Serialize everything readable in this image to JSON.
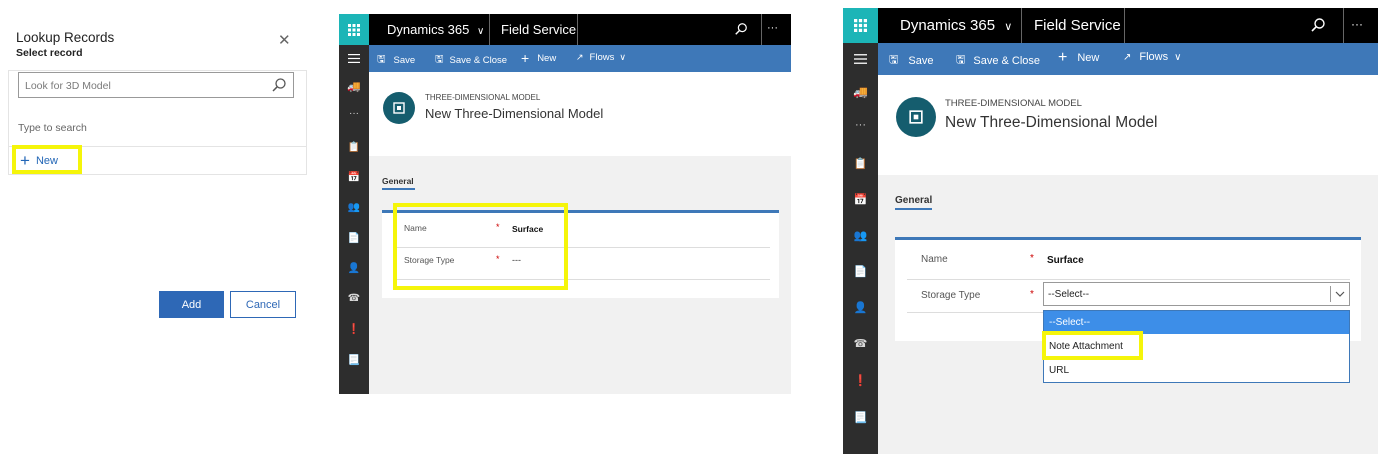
{
  "lookup": {
    "title": "Lookup Records",
    "subtitle": "Select record",
    "close_icon": "close-icon",
    "search_placeholder": "Look for 3D Model",
    "type_to_search": "Type to search",
    "new_label": "New",
    "add_label": "Add",
    "cancel_label": "Cancel"
  },
  "app": {
    "name": "Dynamics 365",
    "chevron": "∨",
    "module": "Field Service",
    "more": "···"
  },
  "command_bar": {
    "save": "Save",
    "save_close": "Save & Close",
    "new": "New",
    "flows": "Flows"
  },
  "record": {
    "entity": "THREE-DIMENSIONAL MODEL",
    "title": "New Three-Dimensional Model",
    "tab": "General"
  },
  "fields": {
    "name_label": "Name",
    "name_value": "Surface",
    "storage_label": "Storage Type",
    "storage_value_empty": "---",
    "required_marker": "*"
  },
  "dropdown": {
    "selected": "--Select--",
    "options": [
      "--Select--",
      "Note Attachment",
      "URL"
    ]
  },
  "colors": {
    "accent": "#3e78b8",
    "waffle": "#1cb5b7",
    "highlight": "#f5f50a",
    "nav_dark": "#2d2d2d"
  }
}
